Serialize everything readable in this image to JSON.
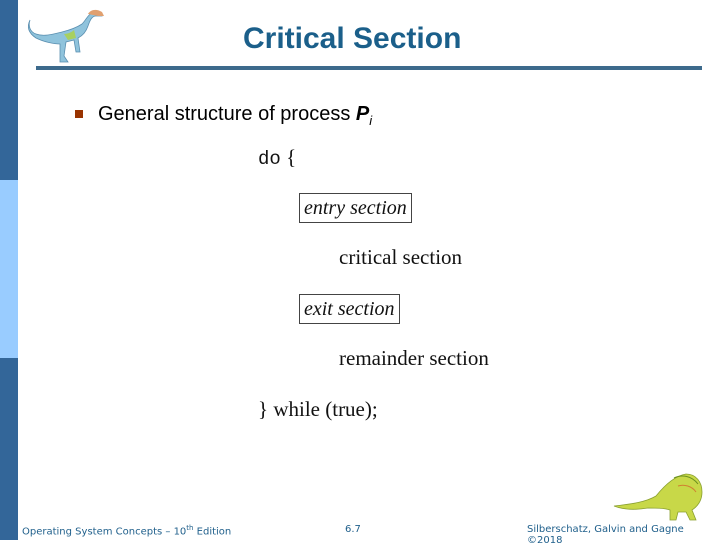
{
  "slide": {
    "title": "Critical Section",
    "bullet": {
      "text": "General structure of process ",
      "process_symbol": "P",
      "process_subscript": "i"
    },
    "code": {
      "do_keyword": "do",
      "open_brace": "{",
      "entry_section": "entry section",
      "critical_section": "critical section",
      "exit_section": "exit section",
      "remainder_section": "remainder section",
      "while_line": "} while (true);"
    },
    "colors": {
      "title": "#1b5f8a",
      "sidebar_dark": "#336699",
      "sidebar_light": "#99ccff",
      "bullet": "#993300",
      "rule": "#3d6a8c"
    }
  },
  "footer": {
    "book_prefix": "Operating System Concepts – 10",
    "book_sup": "th",
    "book_suffix": " Edition",
    "page_number": "6.7",
    "copyright": "Silberschatz, Galvin and Gagne ©2018"
  },
  "icons": {
    "top_logo": "dinosaur-icon",
    "bottom_logo": "dinosaur-icon"
  }
}
